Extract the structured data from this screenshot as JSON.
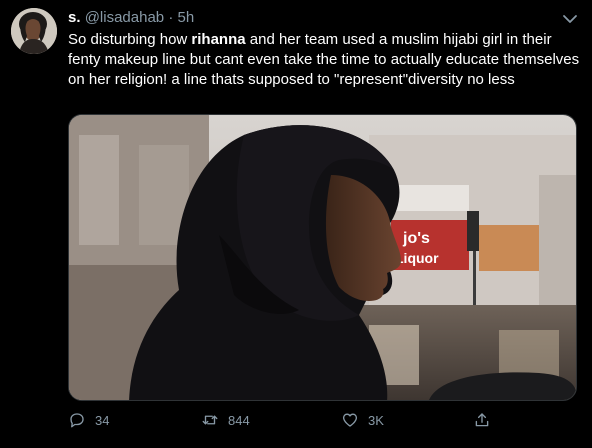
{
  "tweet": {
    "display_name": "s.",
    "handle": "@lisadahab",
    "separator": "·",
    "time": "5h",
    "text_before": "So disturbing how ",
    "text_bold": "rihanna",
    "text_after": " and her team used a muslim hijabi girl in their fenty makeup line but cant even take the time to actually educate themselves on her religion! a line thats supposed to \"represent\"diversity no less"
  },
  "media": {
    "sign_text_1": "jo's",
    "sign_text_2": "Liquor"
  },
  "actions": {
    "reply_count": "34",
    "retweet_count": "844",
    "like_count": "3K"
  },
  "icons": {
    "reply": "reply-icon",
    "retweet": "retweet-icon",
    "like": "like-icon",
    "share": "share-icon",
    "caret": "chevron-down-icon"
  },
  "colors": {
    "background": "#000000",
    "text": "#ffffff",
    "muted": "#8899a6"
  }
}
